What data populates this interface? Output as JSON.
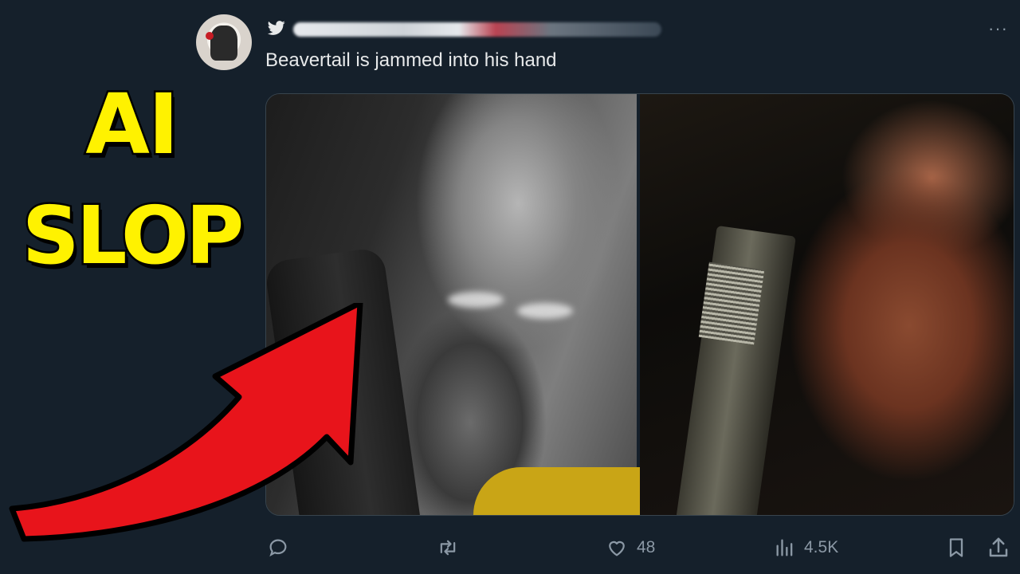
{
  "overlay": {
    "line1": "AI",
    "line2": "SLOP",
    "color": "#fff200",
    "arrow_color": "#e8141b"
  },
  "tweet": {
    "platform_icon": "twitter-bird-icon",
    "text": "Beavertail is jammed into his hand",
    "more_icon": "more-horizontal-icon"
  },
  "actions": {
    "reply_icon": "reply-icon",
    "retweet_icon": "retweet-icon",
    "like_icon": "heart-icon",
    "likes": "48",
    "views_icon": "bar-chart-icon",
    "views": "4.5K",
    "bookmark_icon": "bookmark-icon",
    "share_icon": "share-icon"
  },
  "colors": {
    "background": "#15202b",
    "text": "#e7e9ea",
    "muted": "#8b98a5",
    "twitter_blue": "#1d9bf0"
  }
}
